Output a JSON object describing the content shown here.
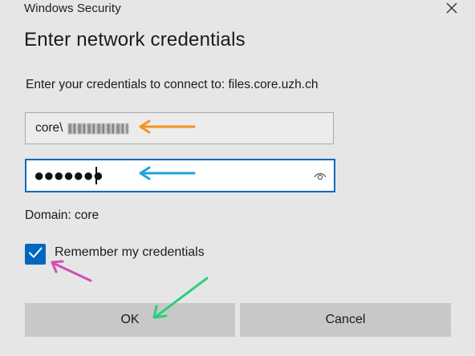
{
  "window": {
    "title": "Windows Security",
    "close_glyph": "✕"
  },
  "dialog": {
    "heading": "Enter network credentials",
    "prompt": "Enter your credentials to connect to: files.core.uzh.ch"
  },
  "username": {
    "value": "core\\"
  },
  "password": {
    "value": "●●●●●●●",
    "reveal_icon": "eye-icon"
  },
  "domain": {
    "label": "Domain: core"
  },
  "remember": {
    "checked": true,
    "label": "Remember my credentials"
  },
  "buttons": {
    "ok_label": "OK",
    "cancel_label": "Cancel"
  },
  "colors": {
    "accent": "#0067c0",
    "arrow_orange": "#f5921e",
    "arrow_blue": "#1fa4dc",
    "arrow_pink": "#d04fb4",
    "arrow_green": "#2ccf7a"
  }
}
